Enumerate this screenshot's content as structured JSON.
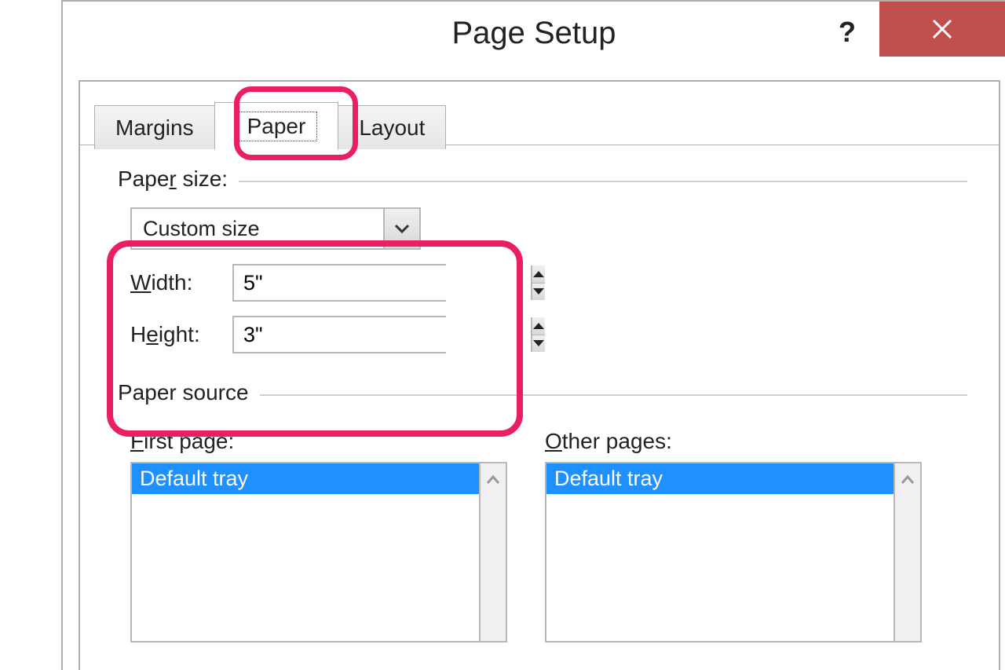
{
  "dialog": {
    "title": "Page Setup",
    "help_icon": "?",
    "close_icon": "close"
  },
  "tabs": {
    "margins": "Margins",
    "paper": "Paper",
    "layout": "Layout",
    "active": "paper"
  },
  "paper_size": {
    "section_label_pre": "Pape",
    "section_label_u": "r",
    "section_label_post": " size:",
    "selected": "Custom size",
    "width_label_u": "W",
    "width_label_post": "idth:",
    "width_value": "5\"",
    "height_label_pre": "H",
    "height_label_u": "e",
    "height_label_post": "ight:",
    "height_value": "3\""
  },
  "paper_source": {
    "section_label": "Paper source",
    "first_page": {
      "label_u": "F",
      "label_post": "irst page:",
      "items": [
        "Default tray"
      ],
      "selected": 0
    },
    "other_pages": {
      "label_u": "O",
      "label_post": "ther pages:",
      "items": [
        "Default tray"
      ],
      "selected": 0
    }
  }
}
